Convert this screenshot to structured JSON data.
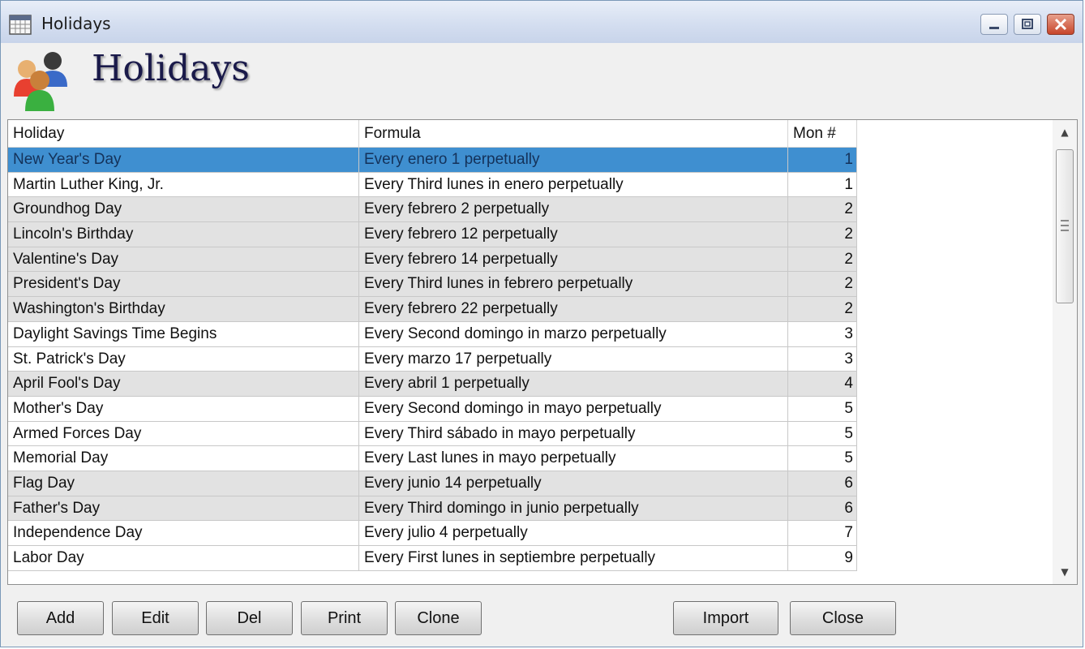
{
  "window": {
    "title": "Holidays"
  },
  "header": {
    "title": "Holidays"
  },
  "table": {
    "columns": [
      "Holiday",
      "Formula",
      "Mon #"
    ],
    "rows": [
      {
        "holiday": "New Year's Day",
        "formula": "Every enero 1 perpetually",
        "mon": "1"
      },
      {
        "holiday": "Martin Luther King, Jr.",
        "formula": "Every Third lunes in enero perpetually",
        "mon": "1"
      },
      {
        "holiday": "Groundhog Day",
        "formula": "Every febrero 2 perpetually",
        "mon": "2"
      },
      {
        "holiday": "Lincoln's Birthday",
        "formula": "Every febrero 12 perpetually",
        "mon": "2"
      },
      {
        "holiday": "Valentine's Day",
        "formula": "Every febrero 14 perpetually",
        "mon": "2"
      },
      {
        "holiday": "President's Day",
        "formula": "Every Third lunes in febrero perpetually",
        "mon": "2"
      },
      {
        "holiday": "Washington's Birthday",
        "formula": "Every febrero 22 perpetually",
        "mon": "2"
      },
      {
        "holiday": "Daylight Savings Time Begins",
        "formula": "Every Second domingo in marzo perpetually",
        "mon": "3"
      },
      {
        "holiday": "St. Patrick's Day",
        "formula": "Every marzo 17 perpetually",
        "mon": "3"
      },
      {
        "holiday": "April Fool's Day",
        "formula": "Every abril 1 perpetually",
        "mon": "4"
      },
      {
        "holiday": "Mother's Day",
        "formula": "Every Second domingo in mayo perpetually",
        "mon": "5"
      },
      {
        "holiday": "Armed Forces Day",
        "formula": "Every Third sábado in mayo perpetually",
        "mon": "5"
      },
      {
        "holiday": "Memorial Day",
        "formula": "Every Last lunes in mayo perpetually",
        "mon": "5"
      },
      {
        "holiday": "Flag Day",
        "formula": "Every junio 14 perpetually",
        "mon": "6"
      },
      {
        "holiday": "Father's Day",
        "formula": "Every Third domingo in junio perpetually",
        "mon": "6"
      },
      {
        "holiday": "Independence Day",
        "formula": "Every julio 4 perpetually",
        "mon": "7"
      },
      {
        "holiday": "Labor Day",
        "formula": "Every First lunes in septiembre perpetually",
        "mon": "9"
      }
    ],
    "selected_row": "New Year's Day",
    "shaded_rows": [
      "Groundhog Day",
      "Lincoln's Birthday",
      "Valentine's Day",
      "President's Day",
      "Washington's Birthday",
      "April Fool's Day",
      "Flag Day",
      "Father's Day"
    ]
  },
  "buttons": {
    "add": "Add",
    "edit": "Edit",
    "del": "Del",
    "print": "Print",
    "clone": "Clone",
    "import": "Import",
    "close": "Close"
  },
  "colors": {
    "selection": "#3f8fd0",
    "title_text": "#1a1a4a"
  }
}
